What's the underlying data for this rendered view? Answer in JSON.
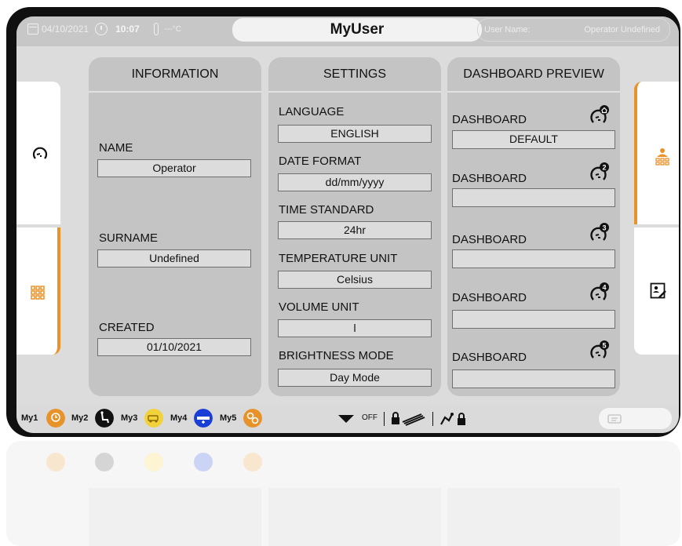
{
  "topbar": {
    "date": "04/10/2021",
    "time": "10:07",
    "temperature": "---°C",
    "title": "MyUser",
    "user_label": "User Name:",
    "user_value": "Operator Undefined"
  },
  "info": {
    "heading": "INFORMATION",
    "name_label": "NAME",
    "name_value": "Operator",
    "surname_label": "SURNAME",
    "surname_value": "Undefined",
    "created_label": "CREATED",
    "created_value": "01/10/2021"
  },
  "settings": {
    "heading": "SETTINGS",
    "language_label": "LANGUAGE",
    "language_value": "ENGLISH",
    "date_format_label": "DATE FORMAT",
    "date_format_value": "dd/mm/yyyy",
    "time_standard_label": "TIME STANDARD",
    "time_standard_value": "24hr",
    "temperature_unit_label": "TEMPERATURE UNIT",
    "temperature_unit_value": "Celsius",
    "volume_unit_label": "VOLUME UNIT",
    "volume_unit_value": "l",
    "brightness_label": "BRIGHTNESS MODE",
    "brightness_value": "Day Mode"
  },
  "dashboard": {
    "heading": "DASHBOARD PREVIEW",
    "items": [
      {
        "label": "DASHBOARD",
        "value": "DEFAULT",
        "badge": "home-icon"
      },
      {
        "label": "DASHBOARD",
        "value": "",
        "badge": "2"
      },
      {
        "label": "DASHBOARD",
        "value": "",
        "badge": "3"
      },
      {
        "label": "DASHBOARD",
        "value": "",
        "badge": "4"
      },
      {
        "label": "DASHBOARD",
        "value": "",
        "badge": "5"
      }
    ]
  },
  "bottombar": {
    "my1": "My1",
    "my2": "My2",
    "my3": "My3",
    "my4": "My4",
    "my5": "My5",
    "off_label": "OFF"
  },
  "colors": {
    "accent": "#e8922a",
    "panel": "#c4c4c4",
    "screen": "#dcdcdc",
    "topbar": "#c7c7c7"
  }
}
